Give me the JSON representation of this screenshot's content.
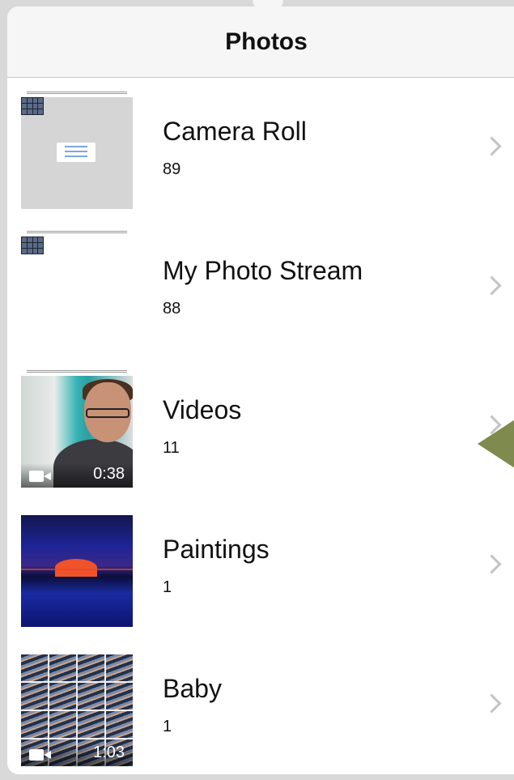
{
  "navbar": {
    "title": "Photos"
  },
  "albums": [
    {
      "title": "Camera Roll",
      "count": "89"
    },
    {
      "title": "My Photo Stream",
      "count": "88"
    },
    {
      "title": "Videos",
      "count": "11",
      "duration": "0:38"
    },
    {
      "title": "Paintings",
      "count": "1"
    },
    {
      "title": "Baby",
      "count": "1",
      "duration": "1:03"
    }
  ],
  "icons": {
    "chevron": "chevron-right-icon",
    "video": "video-camera-icon",
    "pointer": "annotation-arrow"
  },
  "colors": {
    "background": "#d9d9d9",
    "navbar": "#f6f6f6",
    "chevron": "#c3c3c8",
    "annotation": "#7f8a4e"
  }
}
